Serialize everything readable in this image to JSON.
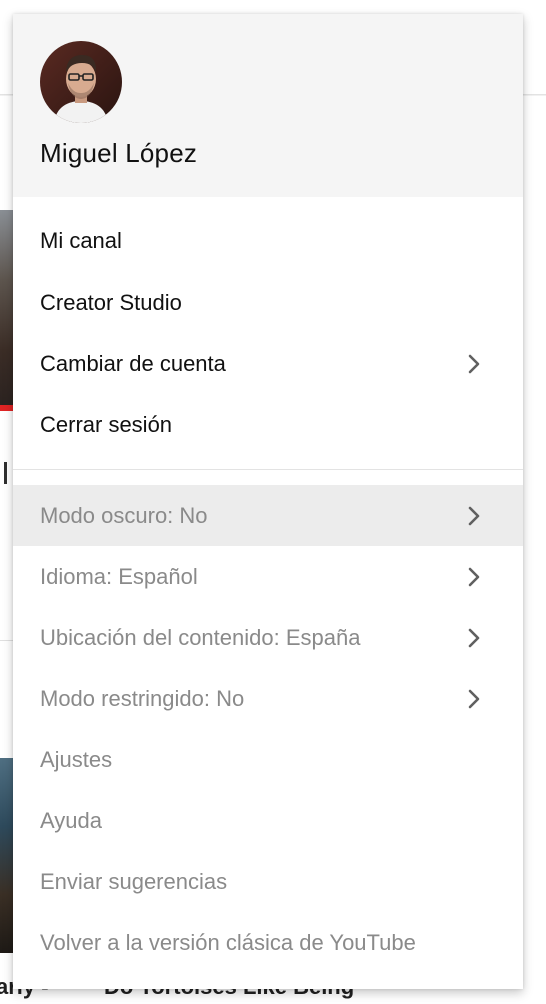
{
  "user": {
    "name": "Miguel López"
  },
  "account_section": [
    {
      "label": "Mi canal",
      "has_submenu": false
    },
    {
      "label": "Creator Studio",
      "has_submenu": false
    },
    {
      "label": "Cambiar de cuenta",
      "has_submenu": true
    },
    {
      "label": "Cerrar sesión",
      "has_submenu": false
    }
  ],
  "settings_section": [
    {
      "label": "Modo oscuro: No",
      "has_submenu": true,
      "highlighted": true
    },
    {
      "label": "Idioma: Español",
      "has_submenu": true
    },
    {
      "label": "Ubicación del contenido: España",
      "has_submenu": true
    },
    {
      "label": "Modo restringido: No",
      "has_submenu": true
    },
    {
      "label": "Ajustes",
      "has_submenu": false
    },
    {
      "label": "Ayuda",
      "has_submenu": false
    },
    {
      "label": "Enviar sugerencias",
      "has_submenu": false
    },
    {
      "label": "Volver a la versión clásica de YouTube",
      "has_submenu": false
    }
  ],
  "background": {
    "video_title_left": "arly -",
    "video_title_right": "Do Tortoises Like Being"
  },
  "icons": {
    "submenu": "chevron-right-icon",
    "avatar": "user-avatar"
  },
  "colors": {
    "menu_header_bg": "#f5f5f5",
    "primary_text": "#111111",
    "secondary_text": "#8a8a8a",
    "hover_bg": "#ececec",
    "chevron": "#606060"
  }
}
